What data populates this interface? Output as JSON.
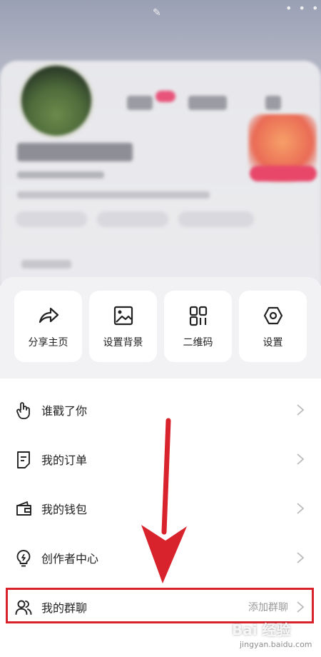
{
  "quick_actions": [
    {
      "label": "分享主页",
      "icon": "share-icon"
    },
    {
      "label": "设置背景",
      "icon": "image-icon"
    },
    {
      "label": "二维码",
      "icon": "qrcode-icon"
    },
    {
      "label": "设置",
      "icon": "settings-icon"
    }
  ],
  "menu": [
    {
      "label": "谁戳了你",
      "icon": "finger-tap-icon"
    },
    {
      "label": "我的订单",
      "icon": "order-icon"
    },
    {
      "label": "我的钱包",
      "icon": "wallet-icon"
    },
    {
      "label": "创作者中心",
      "icon": "lightbulb-icon"
    },
    {
      "label": "我的群聊",
      "icon": "group-icon",
      "extra": "添加群聊"
    }
  ],
  "watermark": {
    "text": "Bai 经验",
    "sub": "jingyan.baidu.com"
  },
  "colors": {
    "highlight": "#d8222c",
    "accent_pink": "#e8547a"
  }
}
